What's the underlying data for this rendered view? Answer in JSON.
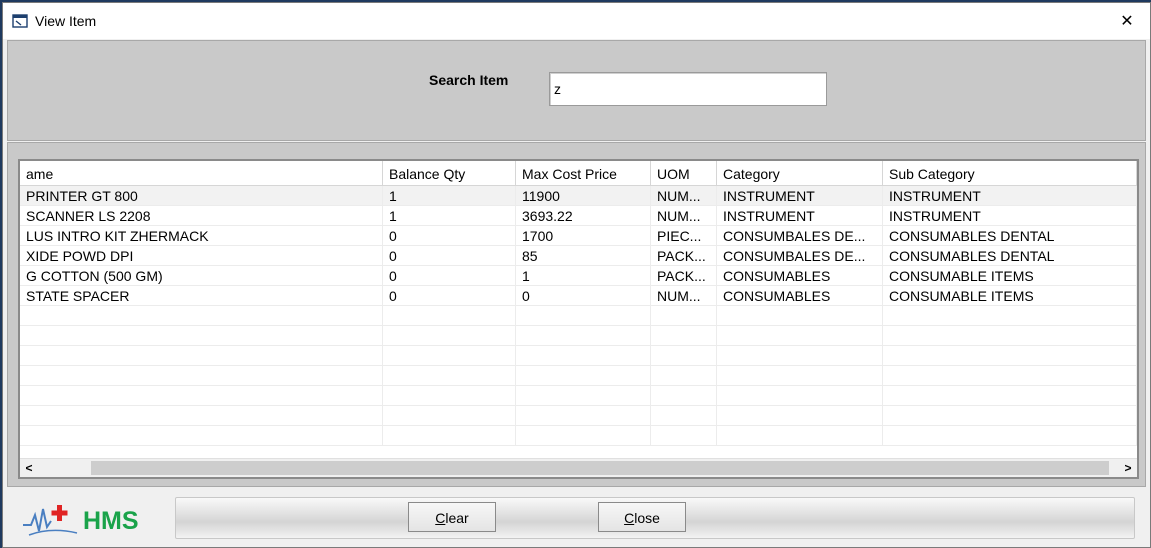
{
  "window": {
    "title": "View Item",
    "close_glyph": "✕"
  },
  "search": {
    "label": "Search Item",
    "value": "z"
  },
  "table": {
    "columns": [
      "ame",
      "Balance Qty",
      "Max Cost Price",
      "UOM",
      "Category",
      "Sub Category"
    ],
    "rows": [
      [
        "PRINTER GT 800",
        "1",
        "11900",
        "NUM...",
        "INSTRUMENT",
        "INSTRUMENT"
      ],
      [
        "SCANNER LS 2208",
        "1",
        "3693.22",
        "NUM...",
        "INSTRUMENT",
        "INSTRUMENT"
      ],
      [
        "LUS INTRO KIT ZHERMACK",
        "0",
        "1700",
        "PIEC...",
        "CONSUMBALES DE...",
        "CONSUMABLES DENTAL"
      ],
      [
        "XIDE POWD DPI",
        "0",
        "85",
        "PACK...",
        "CONSUMBALES DE...",
        "CONSUMABLES DENTAL"
      ],
      [
        "G COTTON (500 GM)",
        "0",
        "1",
        "PACK...",
        "CONSUMABLES",
        "CONSUMABLE ITEMS"
      ],
      [
        "STATE SPACER",
        "0",
        "0",
        "NUM...",
        "CONSUMABLES",
        "CONSUMABLE ITEMS"
      ]
    ],
    "empty_rows": 7,
    "scroll_left_glyph": "<",
    "scroll_right_glyph": ">"
  },
  "footer": {
    "logo_text": "HMS",
    "clear_button": {
      "mnemonic": "C",
      "rest": "lear"
    },
    "close_button": {
      "mnemonic": "C",
      "rest": "lose"
    }
  },
  "colors": {
    "accent_green": "#1aa34a",
    "accent_red": "#e02424",
    "panel_gray": "#c9c9c9"
  },
  "icons": [
    "window-app-icon",
    "hms-logo-icon"
  ]
}
